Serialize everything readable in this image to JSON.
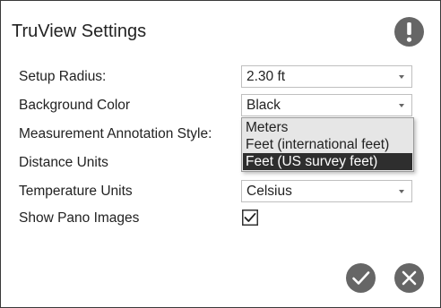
{
  "dialog": {
    "title": "TruView Settings",
    "alert_icon": "exclamation-circle-icon",
    "accent_color": "#666666"
  },
  "settings": {
    "setup_radius": {
      "label": "Setup Radius:",
      "value": "2.30 ft"
    },
    "background_color": {
      "label": "Background Color",
      "value": "Black",
      "options": [
        "Meters",
        "Feet (international feet)",
        "Feet (US survey feet)"
      ],
      "highlighted_option": "Feet (US survey feet)"
    },
    "measurement_annotation_style": {
      "label": "Measurement Annotation Style:"
    },
    "distance_units": {
      "label": "Distance Units"
    },
    "temperature_units": {
      "label": "Temperature Units",
      "value": "Celsius"
    },
    "show_pano_images": {
      "label": "Show Pano Images",
      "checked": true
    }
  },
  "actions": {
    "confirm_icon": "checkmark-icon",
    "cancel_icon": "close-icon"
  }
}
